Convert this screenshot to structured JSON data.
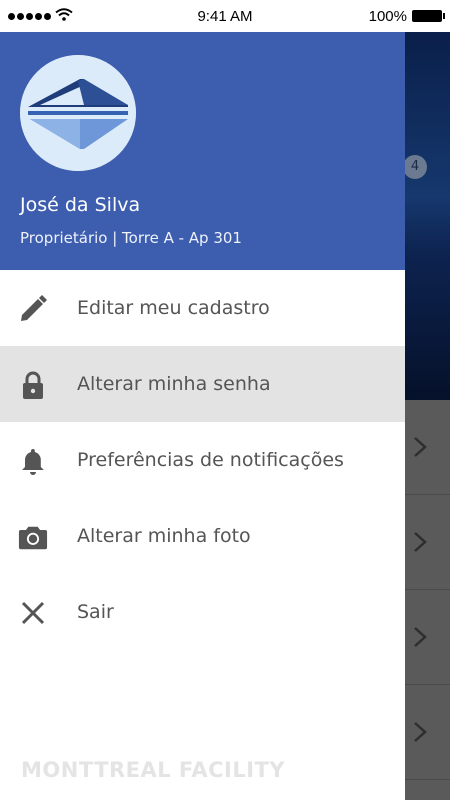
{
  "status_bar": {
    "time": "9:41 AM",
    "battery": "100%",
    "signal_icon": "signal-dots-icon",
    "wifi_icon": "wifi-icon",
    "battery_icon": "battery-icon"
  },
  "background": {
    "badge_count": "4",
    "chevron_icon": "chevron-right-icon"
  },
  "drawer": {
    "user": {
      "name": "José da Silva",
      "role": "Proprietário | Torre A - Ap 301",
      "avatar_icon": "building-logo-icon"
    },
    "menu": [
      {
        "label": "Editar meu cadastro",
        "icon": "pencil-icon",
        "active": false
      },
      {
        "label": "Alterar minha senha",
        "icon": "lock-icon",
        "active": true
      },
      {
        "label": "Preferências de notificações",
        "icon": "bell-icon",
        "active": false
      },
      {
        "label": "Alterar minha foto",
        "icon": "camera-icon",
        "active": false
      },
      {
        "label": "Sair",
        "icon": "close-icon",
        "active": false
      }
    ],
    "footer_brand": "MONTTREAL FACILITY"
  },
  "colors": {
    "header_bg": "#3d5daf",
    "active_item_bg": "#e3e3e3",
    "icon_color": "#555555",
    "brand_text": "#e4e4e4"
  }
}
